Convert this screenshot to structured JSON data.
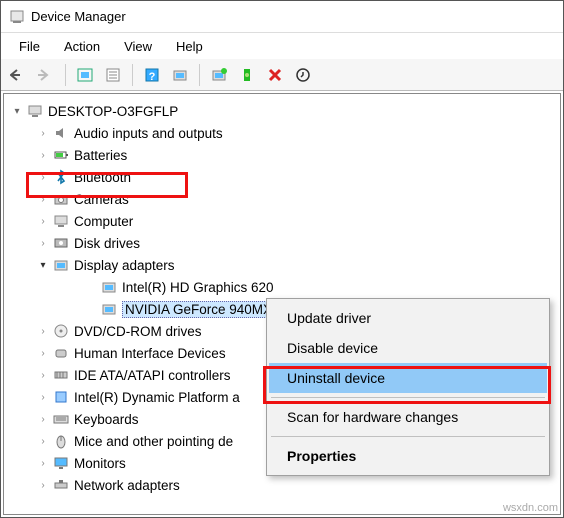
{
  "window": {
    "title": "Device Manager"
  },
  "menubar": [
    "File",
    "Action",
    "View",
    "Help"
  ],
  "root_node": "DESKTOP-O3FGFLP",
  "categories": [
    {
      "label": "Audio inputs and outputs",
      "expandable": true
    },
    {
      "label": "Batteries",
      "expandable": true
    },
    {
      "label": "Bluetooth",
      "expandable": true
    },
    {
      "label": "Cameras",
      "expandable": true
    },
    {
      "label": "Computer",
      "expandable": true
    },
    {
      "label": "Disk drives",
      "expandable": true
    },
    {
      "label": "Display adapters",
      "expandable": true,
      "expanded": true,
      "highlight_red": true,
      "children": [
        {
          "label": "Intel(R) HD Graphics 620"
        },
        {
          "label": "NVIDIA GeForce 940MX",
          "selected": true
        }
      ]
    },
    {
      "label": "DVD/CD-ROM drives",
      "expandable": true
    },
    {
      "label": "Human Interface Devices",
      "expandable": true
    },
    {
      "label": "IDE ATA/ATAPI controllers",
      "expandable": true
    },
    {
      "label": "Intel(R) Dynamic Platform a",
      "expandable": true
    },
    {
      "label": "Keyboards",
      "expandable": true
    },
    {
      "label": "Mice and other pointing de",
      "expandable": true
    },
    {
      "label": "Monitors",
      "expandable": true
    },
    {
      "label": "Network adapters",
      "expandable": true
    }
  ],
  "context_menu": {
    "items": [
      {
        "label": "Update driver"
      },
      {
        "label": "Disable device"
      },
      {
        "label": "Uninstall device",
        "highlight": true,
        "red_box": true
      },
      {
        "sep": true
      },
      {
        "label": "Scan for hardware changes"
      },
      {
        "sep": true
      },
      {
        "label": "Properties",
        "bold": true
      }
    ]
  },
  "watermark": "wsxdn.com"
}
